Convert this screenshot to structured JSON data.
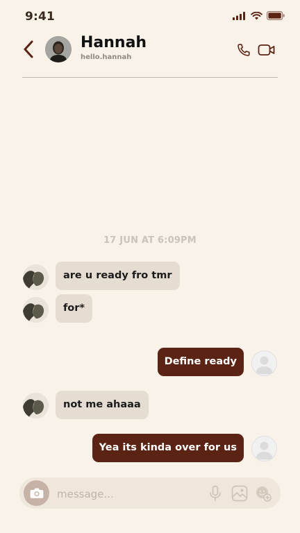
{
  "status_bar": {
    "time": "9:41"
  },
  "header": {
    "name": "Hannah",
    "handle": "hello.hannah"
  },
  "timestamp": "17 JUN AT 6:09PM",
  "messages": [
    {
      "direction": "in",
      "text": "are u ready fro tmr"
    },
    {
      "direction": "in",
      "text": "for*"
    },
    {
      "direction": "out",
      "text": "Define ready"
    },
    {
      "direction": "in",
      "text": "not me ahaaa"
    },
    {
      "direction": "out",
      "text": "Yea its kinda over for us"
    }
  ],
  "composer": {
    "placeholder": "message..."
  },
  "colors": {
    "background": "#f8f2e9",
    "accent": "#5a2313",
    "incoming_bubble": "#e6ddd2",
    "icon": "#5a2313"
  },
  "icons": [
    "back-chevron-icon",
    "phone-icon",
    "video-camera-icon",
    "camera-icon",
    "microphone-icon",
    "image-icon",
    "sticker-icon"
  ]
}
